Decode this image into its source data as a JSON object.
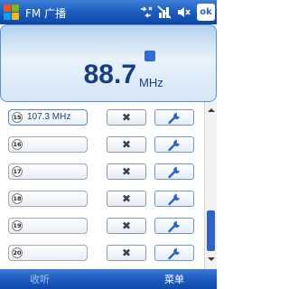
{
  "title_bar": {
    "app_title": "FM 广播",
    "icons": [
      "windows-start-icon",
      "connectivity-icon",
      "signal-off-icon",
      "volume-muted-icon"
    ],
    "ok_label": "ok"
  },
  "display": {
    "frequency": "88.7",
    "unit": "MHz"
  },
  "presets": [
    {
      "number": "15",
      "label": "107.3 MHz",
      "active": true
    },
    {
      "number": "16",
      "label": "",
      "active": false
    },
    {
      "number": "17",
      "label": "",
      "active": false
    },
    {
      "number": "18",
      "label": "",
      "active": false
    },
    {
      "number": "19",
      "label": "",
      "active": false
    },
    {
      "number": "20",
      "label": "",
      "active": false
    }
  ],
  "row_actions": {
    "delete_icon": "close-icon",
    "edit_icon": "wrench-icon"
  },
  "softkeys": {
    "left": "收听",
    "right": "菜单"
  },
  "colors": {
    "title_bar": "#1f5fc3",
    "accent": "#2d62c7",
    "frequency_text": "#163e84"
  }
}
